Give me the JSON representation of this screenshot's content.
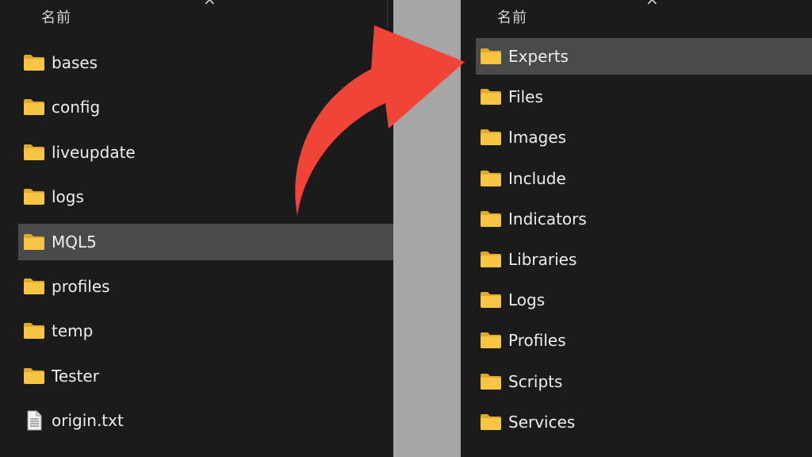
{
  "left_panel": {
    "column_header": "名前",
    "items": [
      {
        "label": "bases",
        "type": "folder"
      },
      {
        "label": "config",
        "type": "folder"
      },
      {
        "label": "liveupdate",
        "type": "folder"
      },
      {
        "label": "logs",
        "type": "folder"
      },
      {
        "label": "MQL5",
        "type": "folder",
        "selected": true
      },
      {
        "label": "profiles",
        "type": "folder"
      },
      {
        "label": "temp",
        "type": "folder"
      },
      {
        "label": "Tester",
        "type": "folder"
      },
      {
        "label": "origin.txt",
        "type": "file"
      }
    ]
  },
  "right_panel": {
    "column_header": "名前",
    "items": [
      {
        "label": "Experts",
        "type": "folder",
        "selected": true
      },
      {
        "label": "Files",
        "type": "folder"
      },
      {
        "label": "Images",
        "type": "folder"
      },
      {
        "label": "Include",
        "type": "folder"
      },
      {
        "label": "Indicators",
        "type": "folder"
      },
      {
        "label": "Libraries",
        "type": "folder"
      },
      {
        "label": "Logs",
        "type": "folder"
      },
      {
        "label": "Profiles",
        "type": "folder"
      },
      {
        "label": "Scripts",
        "type": "folder"
      },
      {
        "label": "Services",
        "type": "folder"
      }
    ]
  },
  "colors": {
    "arrow": "#f04438",
    "folder": "#f7c543",
    "folder_back": "#e0a92a",
    "selected_row": "#4a4a4a",
    "panel_bg": "#1b1b1b",
    "gap_bg": "#a6a6a6"
  },
  "icons": {
    "folder": "folder-icon",
    "file": "text-file-icon",
    "arrow": "curved-arrow"
  }
}
